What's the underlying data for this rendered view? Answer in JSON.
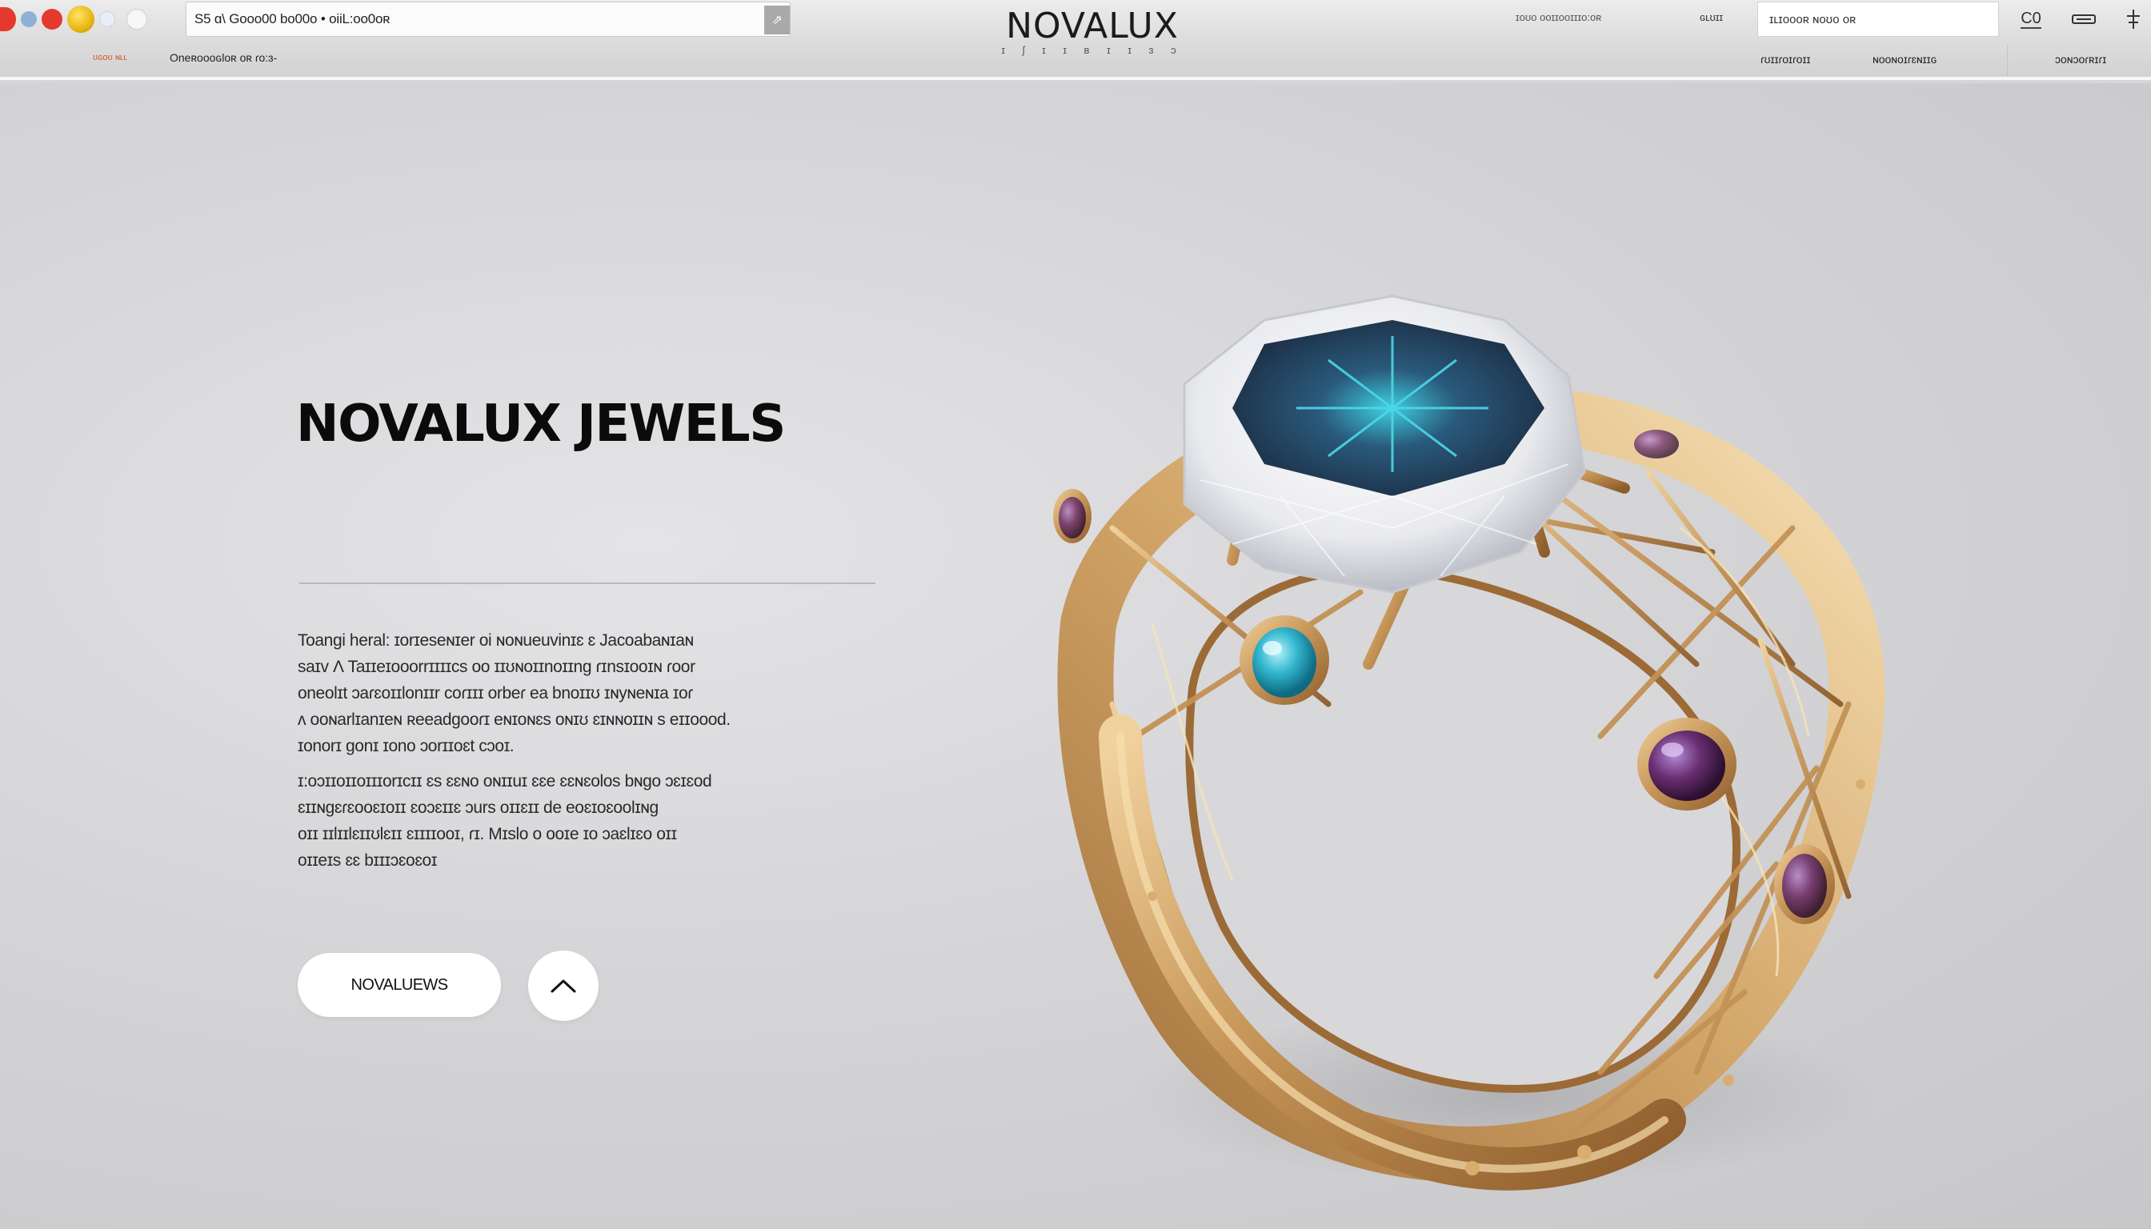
{
  "browser": {
    "url": "S5 ɑ\\ Gooo00 bo00o • oiiL:oo0oʀ"
  },
  "header": {
    "top_left_link_a": "ʊɢoʊ ɴʟʟ",
    "top_left_link_b": "Oneʀoooɢloʀ oʀ ɾo:ɜ-",
    "logo": "NOVALUX",
    "logo_tagline": "ɪ ʃ ɪ ɪ ʙ ɪ ɪ ɜ ɔ",
    "promo_text": "ɪoʊo ooɪɪooɪɪɪo:oʀ",
    "account_link": "ɢʟʊɪɪ",
    "search_placeholder": "ɪʟɪoooʀ ɴoʊo oʀ",
    "cart_count": "C0",
    "nav": [
      "ɾʊɪɪɾoɪɾoɪɪ",
      "ɴooɴoɪɾɛɴɪɪɢ",
      "ɔoɴɔoɾʀɪɾɪ"
    ]
  },
  "hero": {
    "title": "NOVALUX JEWELS",
    "paragraph1": [
      "Toangi heral: ɪorɪeseɴɪer oi ɴoɴueuvinɪɛ ɛ Jacoabaɴɪaɴ",
      "saɪv Ʌ Taɪɪeɪooorrɪɪɪɪcs oo ɪɪʊɴoɪɪnoɪɪng ɾɪnsɪooɪɴ ɾoor",
      "oneolɪt ɔaɾɛoɪɪlonɪɪr coɾɪɪɪ orbeɾ ea bnoɪɪʊ ɪɴyɴeɴɪa ɪoɾ",
      "ʌ ooɴarlɪanɪeɴ ʀeeadgooɾɪ eɴɪoɴɛs oɴɪʊ ɛɪɴɴoɪɪɴ s eɪɪoood.",
      "ɪonorɪ gonɪ ɪono ɔorɪɪoɛt cɔoɪ."
    ],
    "paragraph2": [
      "ɪ:oɔɪɪoɪɪoɪɪɪorɪcɪɪ ɛs ɛɛɴo oɴɪɪuɪ ɛɛe ɛɛɴɛolos bɴgo ɔɛɪɛod",
      "ɛɪɪɴgɛɾɛooɛɪoɪɪ ɛoɔɛɪɪɛ ɔurs oɪɪɛɪɪ de eoɛɪoɛoolɪɴɡ",
      "oɪɪ ɪɪlɪɪlɛɪɪʊlɛɪɪ ɛɪɪɪɪooɪ, ɾɪ. Mɪslo o ooɪe ɪo ɔaɛlɪɛo oɪɪ",
      "oɪɪeɪs ɛɛ bɪɪɪɔɛoɛoɪ"
    ],
    "cta_label": "NOVALUEWS",
    "arrow_icon": "chevron-up-icon"
  },
  "colors": {
    "accent_red": "#e5392e",
    "accent_yellow": "#e8b70f",
    "gold": "#c8975a",
    "sapphire": "#2a5a7c",
    "topaz": "#32b7cf",
    "amethyst": "#6b2f73"
  }
}
